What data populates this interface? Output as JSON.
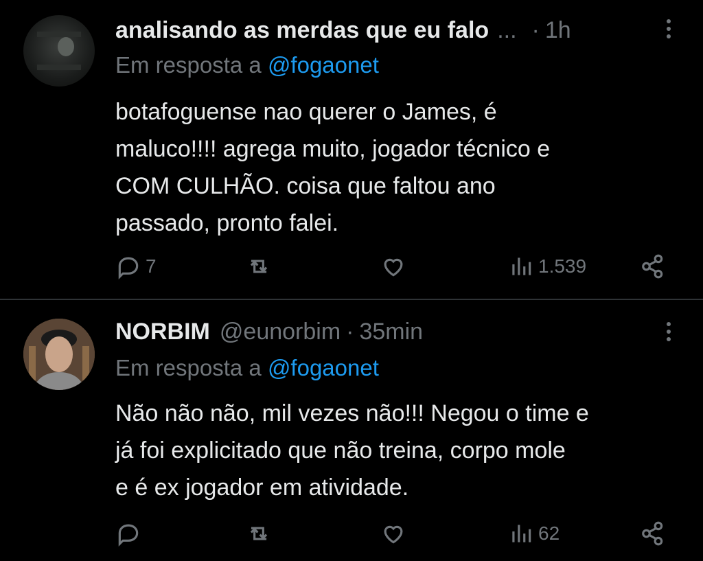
{
  "tweets": [
    {
      "name": "analisando as merdas que eu falo",
      "handle": "",
      "truncated": "...",
      "dot": "·",
      "time": "1h",
      "reply_prefix": "Em resposta a",
      "reply_mention": "@fogaonet",
      "text_lines": [
        "botafoguense nao querer o James, é",
        "maluco!!!! agrega muito, jogador técnico e",
        "COM CULHÃO. coisa que faltou ano",
        "passado, pronto falei."
      ],
      "replies": "7",
      "retweets": "",
      "likes": "",
      "views": "1.539"
    },
    {
      "name": "NORBIM",
      "handle": "@eunorbim",
      "truncated": "",
      "dot": "·",
      "time": "35min",
      "reply_prefix": "Em resposta a",
      "reply_mention": "@fogaonet",
      "text_lines": [
        "Não não não, mil vezes não!!! Negou o time e",
        "já foi explicitado que não treina, corpo mole",
        "e é ex jogador em atividade."
      ],
      "replies": "",
      "retweets": "",
      "likes": "",
      "views": "62"
    }
  ],
  "icons": {
    "reply": "reply-icon",
    "retweet": "retweet-icon",
    "like": "like-icon",
    "views": "views-icon",
    "share": "share-icon",
    "more": "more-icon"
  },
  "colors": {
    "background": "#000000",
    "text": "#e7e9ea",
    "muted": "#71767b",
    "link": "#1d9bf0",
    "divider": "#2f3336"
  }
}
